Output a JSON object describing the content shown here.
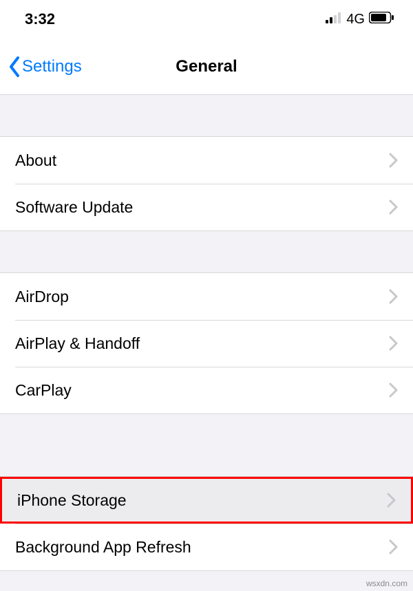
{
  "status_bar": {
    "time": "3:32",
    "network_label": "4G"
  },
  "nav": {
    "back_label": "Settings",
    "title": "General"
  },
  "groups": [
    {
      "items": [
        {
          "label": "About",
          "highlight": false
        },
        {
          "label": "Software Update",
          "highlight": false
        }
      ]
    },
    {
      "items": [
        {
          "label": "AirDrop",
          "highlight": false
        },
        {
          "label": "AirPlay & Handoff",
          "highlight": false
        },
        {
          "label": "CarPlay",
          "highlight": false
        }
      ]
    },
    {
      "items": [
        {
          "label": "iPhone Storage",
          "highlight": true
        },
        {
          "label": "Background App Refresh",
          "highlight": false
        }
      ]
    }
  ],
  "watermark": "wsxdn.com"
}
